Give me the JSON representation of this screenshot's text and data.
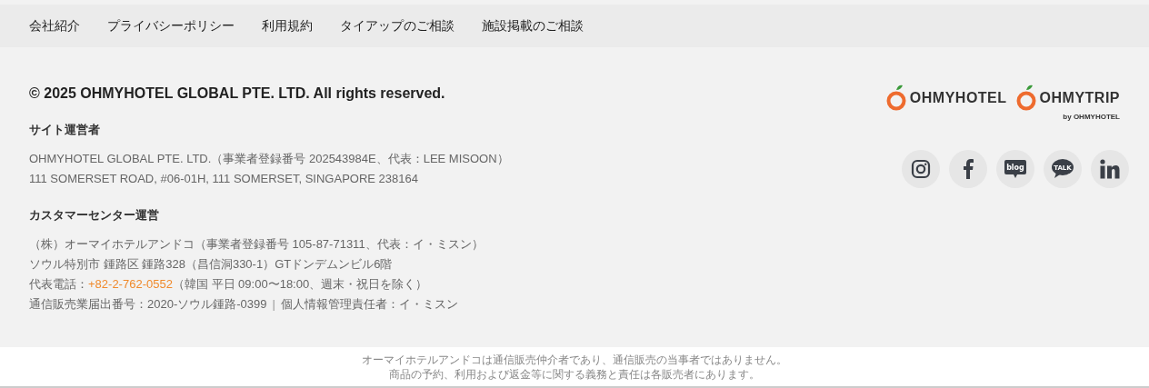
{
  "nav": [
    "会社紹介",
    "プライバシーポリシー",
    "利用規約",
    "タイアップのご相談",
    "施設掲載のご相談"
  ],
  "copyright": "© 2025 OHMYHOTEL GLOBAL PTE. LTD. All rights reserved.",
  "sections": [
    {
      "heading": "サイト運営者",
      "lines": [
        "OHMYHOTEL GLOBAL PTE. LTD.（事業者登録番号 202543984E、代表：LEE MISOON）",
        "111 SOMERSET ROAD, #06-01H, 111 SOMERSET, SINGAPORE 238164"
      ]
    },
    {
      "heading": "カスタマーセンター運営",
      "lines": [
        "（株）オーマイホテルアンドコ（事業者登録番号 105-87-71311、代表：イ・ミスン）",
        "ソウル特別市 鍾路区 鍾路328（昌信洞330-1）GTドンデムンビル6階"
      ],
      "phone": {
        "label": "代表電話：",
        "number": "+82-2-762-0552",
        "note": "（韓国 平日 09:00〜18:00、週末・祝日を除く）"
      },
      "last_line": [
        "通信販売業届出番号：2020-ソウル鍾路-0399",
        "|",
        "個人情報管理責任者：イ・ミスン"
      ]
    }
  ],
  "logos": [
    {
      "name": "OHMYHOTEL"
    },
    {
      "name": "OHMYTRIP",
      "byline": "by OHMYHOTEL"
    }
  ],
  "social": [
    {
      "kind": "instagram"
    },
    {
      "kind": "facebook"
    },
    {
      "kind": "blog",
      "label": "blog"
    },
    {
      "kind": "talk",
      "label": "TALK"
    },
    {
      "kind": "linkedin"
    }
  ],
  "disclaimer": [
    "オーマイホテルアンドコは通信販売仲介者であり、通信販売の当事者ではありません。",
    "商品の予約、利用および返金等に関する義務と責任は各販売者にあります。"
  ]
}
